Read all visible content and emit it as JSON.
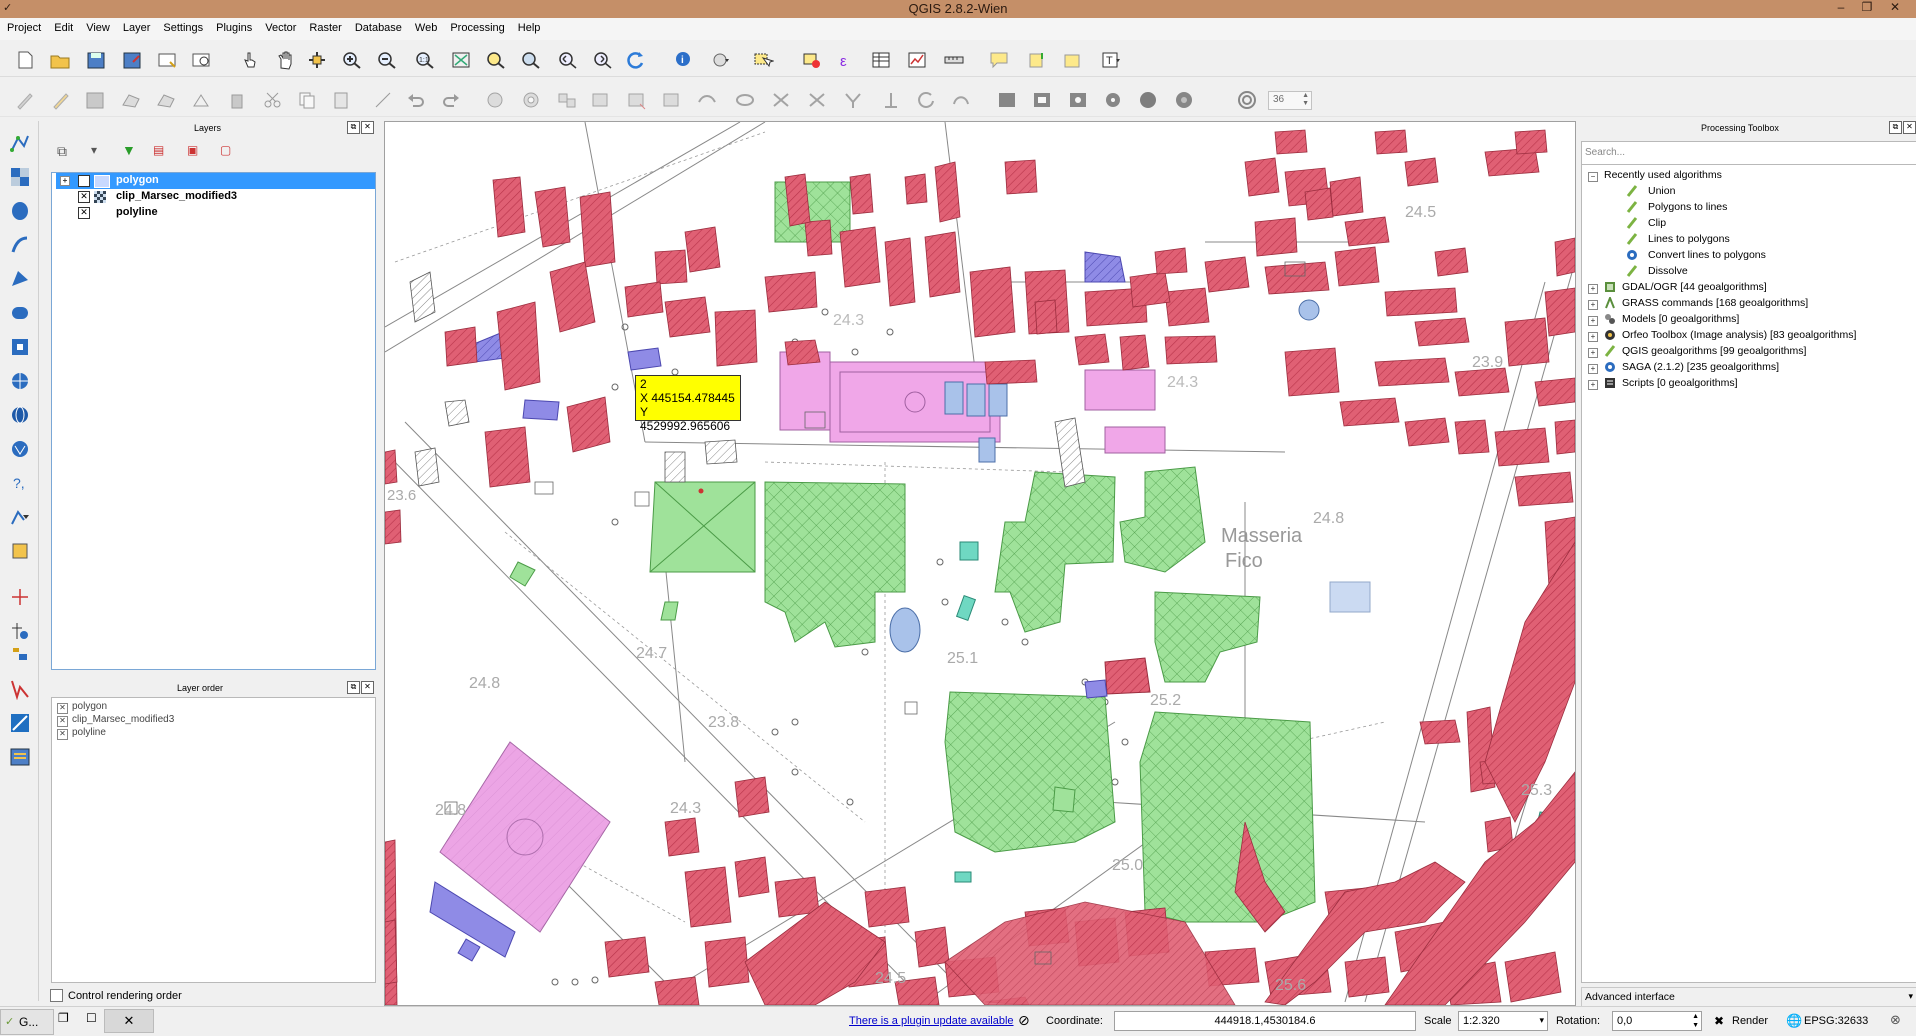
{
  "window": {
    "title": "QGIS 2.8.2-Wien"
  },
  "menu": [
    "Project",
    "Edit",
    "View",
    "Layer",
    "Settings",
    "Plugins",
    "Vector",
    "Raster",
    "Database",
    "Web",
    "Processing",
    "Help"
  ],
  "layers_panel": {
    "title": "Layers",
    "layers": [
      {
        "name": "polygon",
        "checked": true,
        "selected": true
      },
      {
        "name": "clip_Marsec_modified3",
        "checked": true,
        "selected": false
      },
      {
        "name": "polyline",
        "checked": true,
        "selected": false
      }
    ]
  },
  "layer_order_panel": {
    "title": "Layer order",
    "layers": [
      "polygon",
      "clip_Marsec_modified3",
      "polyline"
    ],
    "control_rendering_label": "Control rendering order",
    "control_rendering_checked": false
  },
  "map": {
    "tooltip": {
      "line1": "2",
      "line2": "X 445154.478445",
      "line3": "Y 4529992.965606"
    },
    "labels": [
      "24.3",
      "24.3",
      "24.7",
      "24.8",
      "23.8",
      "24.3",
      "25.1",
      "25.2",
      "25.0",
      "24.8",
      "24.5",
      "23.9",
      "25.3",
      "23.6",
      "Masseria",
      "Fico",
      "25.6",
      "24.5",
      "24.8"
    ],
    "colors": {
      "building": "#e06074",
      "green": "#9fe29a",
      "pink": "#f0a7e8",
      "blue": "#a9c2ea",
      "violet": "#8f8be6",
      "teal": "#6fd8c2"
    }
  },
  "processing": {
    "title": "Processing Toolbox",
    "search_placeholder": "Search...",
    "recent_label": "Recently used algorithms",
    "recent": [
      "Union",
      "Polygons to lines",
      "Clip",
      "Lines to polygons",
      "Convert lines to polygons",
      "Dissolve"
    ],
    "providers": [
      "GDAL/OGR [44 geoalgorithms]",
      "GRASS commands [168 geoalgorithms]",
      "Models [0 geoalgorithms]",
      "Orfeo Toolbox (Image analysis) [83 geoalgorithms]",
      "QGIS geoalgorithms [99 geoalgorithms]",
      "SAGA (2.1.2) [235 geoalgorithms]",
      "Scripts [0 geoalgorithms]"
    ],
    "interface_mode": "Advanced interface"
  },
  "toolbar": {
    "snapping_value": "36"
  },
  "status": {
    "plugin_update": "There is a plugin update available",
    "coordinate_label": "Coordinate:",
    "coordinate_value": "444918.1,4530184.6",
    "scale_label": "Scale",
    "scale_value": "1:2.320",
    "rotation_label": "Rotation:",
    "rotation_value": "0,0",
    "render_label": "Render",
    "crs": "EPSG:32633"
  },
  "taskbar": {
    "app_label": "G..."
  }
}
